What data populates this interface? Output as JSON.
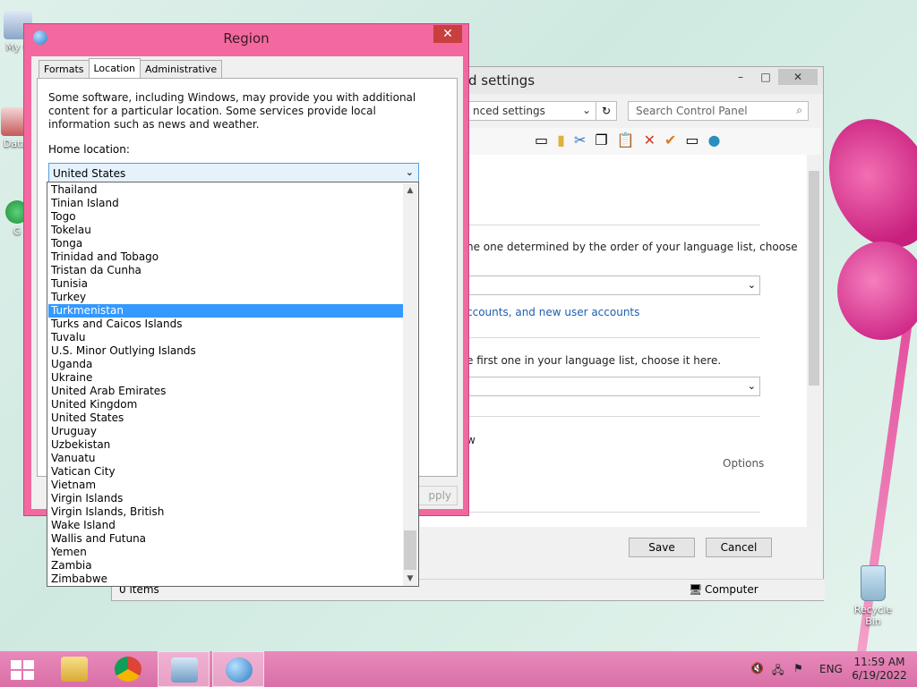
{
  "desktop": {
    "icons": [
      {
        "label": "My C"
      },
      {
        "label": "Data"
      },
      {
        "label": "G"
      }
    ],
    "recycle_bin": {
      "label": "Recycle Bin"
    }
  },
  "control_panel": {
    "title": "d settings",
    "address": "nced settings",
    "search_placeholder": "Search Control Panel",
    "text1": "ne one determined by the order of your language list, choose",
    "link1": "ccounts, and new user accounts",
    "text2": "e first one in your language list, choose it here.",
    "text3": "w",
    "options": "Options",
    "save": "Save",
    "cancel": "Cancel",
    "status_items": "0 items",
    "status_computer": "Computer"
  },
  "region_dialog": {
    "title": "Region",
    "close": "✕",
    "tabs": [
      {
        "label": "Formats"
      },
      {
        "label": "Location"
      },
      {
        "label": "Administrative"
      }
    ],
    "description": "Some software, including Windows, may provide you with additional content for a particular location. Some services provide local information such as news and weather.",
    "home_location_label": "Home location:",
    "home_location_value": "United States",
    "apply_label": "pply"
  },
  "dropdown": {
    "selected_index": 9,
    "items": [
      "Thailand",
      "Tinian Island",
      "Togo",
      "Tokelau",
      "Tonga",
      "Trinidad and Tobago",
      "Tristan da Cunha",
      "Tunisia",
      "Turkey",
      "Turkmenistan",
      "Turks and Caicos Islands",
      "Tuvalu",
      "U.S. Minor Outlying Islands",
      "Uganda",
      "Ukraine",
      "United Arab Emirates",
      "United Kingdom",
      "United States",
      "Uruguay",
      "Uzbekistan",
      "Vanuatu",
      "Vatican City",
      "Vietnam",
      "Virgin Islands",
      "Virgin Islands, British",
      "Wake Island",
      "Wallis and Futuna",
      "Yemen",
      "Zambia",
      "Zimbabwe"
    ]
  },
  "taskbar": {
    "language": "ENG",
    "time": "11:59 AM",
    "date": "6/19/2022"
  },
  "colors": {
    "dialog_frame": "#f2689f",
    "selection": "#3399ff",
    "taskbar": "#d96fa6"
  }
}
